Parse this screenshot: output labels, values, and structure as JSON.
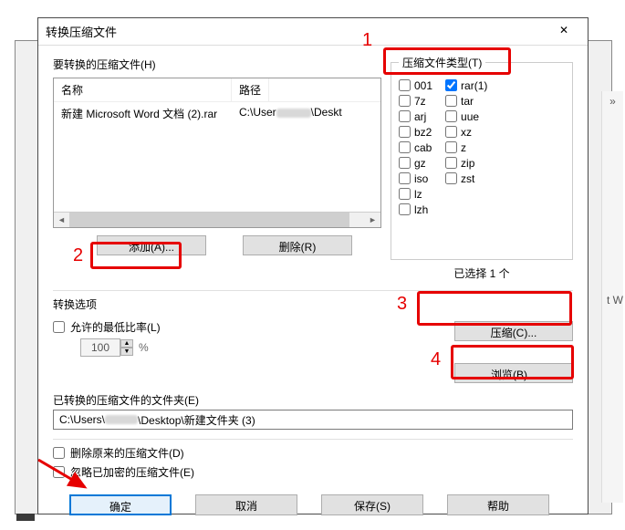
{
  "window": {
    "title": "转换压缩文件",
    "close": "✕"
  },
  "files_section_label": "要转换的压缩文件(H)",
  "file_table": {
    "headers": {
      "name": "名称",
      "path": "路径"
    },
    "rows": [
      {
        "name": "新建 Microsoft Word 文档 (2).rar",
        "path_pre": "C:\\User",
        "path_post": "\\Deskt"
      }
    ]
  },
  "buttons": {
    "add": "添加(A)...",
    "remove": "删除(R)",
    "compress": "压缩(C)...",
    "browse": "浏览(B)...",
    "ok": "确定",
    "cancel": "取消",
    "save": "保存(S)",
    "help": "帮助"
  },
  "archive_types": {
    "legend": "压缩文件类型(T)",
    "col1": [
      "001",
      "7z",
      "arj",
      "bz2",
      "cab",
      "gz",
      "iso",
      "lz",
      "lzh"
    ],
    "col2": [
      "rar(1)",
      "tar",
      "uue",
      "xz",
      "z",
      "zip",
      "zst"
    ],
    "checked": [
      "rar(1)"
    ],
    "selected_text": "已选择 1 个"
  },
  "options": {
    "section": "转换选项",
    "min_ratio_label": "允许的最低比率(L)",
    "min_ratio_value": "100",
    "percent": "%",
    "folder_label": "已转换的压缩文件的文件夹(E)",
    "folder_path_pre": "C:\\Users\\",
    "folder_path_post": "\\Desktop\\新建文件夹 (3)",
    "delete_orig": "删除原来的压缩文件(D)",
    "ignore_encrypted": "忽略已加密的压缩文件(E)"
  },
  "annotations": {
    "n1": "1",
    "n2": "2",
    "n3": "3",
    "n4": "4"
  },
  "bg": {
    "chev": "»",
    "tw": "t W"
  }
}
